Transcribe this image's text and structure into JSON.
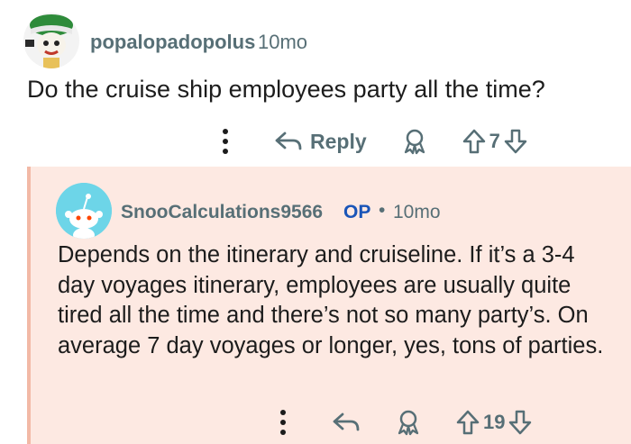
{
  "comment": {
    "username": "popalopadopolus",
    "time": "10mo",
    "text": "Do the cruise ship employees party all the time?",
    "reply_label": "Reply",
    "votes": "7"
  },
  "reply": {
    "username": "SnooCalculations9566",
    "op_badge": "OP",
    "separator": "•",
    "time": "10mo",
    "text": "Depends on the itinerary and cruiseline. If it’s a 3-4 day voyages itinerary, employees are usually quite tired all the time and there’s not so many party’s. On average 7 day voyages or longer, yes, tons of parties.",
    "votes": "19"
  },
  "colors": {
    "meta": "#576f76",
    "op": "#1a55b8",
    "reply_bg": "#fde9e2",
    "reply_border": "#f2b9a6"
  },
  "icons": [
    "more-dots-icon",
    "reply-arrow-icon",
    "award-icon",
    "upvote-icon",
    "downvote-icon"
  ]
}
